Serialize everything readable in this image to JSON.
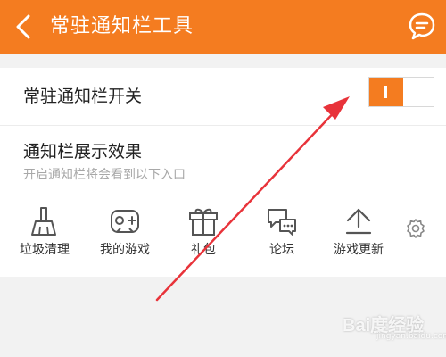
{
  "header": {
    "title": "常驻通知栏工具",
    "back_icon": "chevron-left-icon",
    "chat_icon": "chat-bubble-icon",
    "bg_color": "#f47c20"
  },
  "toggle": {
    "label": "常驻通知栏开关",
    "state": "on",
    "accent_color": "#f47c20"
  },
  "effect": {
    "title": "通知栏展示效果",
    "subtitle": "开启通知栏将会看到以下入口"
  },
  "shortcuts": [
    {
      "label": "垃圾清理",
      "icon": "broom-icon"
    },
    {
      "label": "我的游戏",
      "icon": "gamepad-icon"
    },
    {
      "label": "礼包",
      "icon": "gift-icon"
    },
    {
      "label": "论坛",
      "icon": "forum-icon"
    },
    {
      "label": "游戏更新",
      "icon": "upload-icon"
    }
  ],
  "settings_icon": "gear-icon",
  "annotation": {
    "arrow_color": "#e8333a"
  },
  "watermark": {
    "text": "Bai度经验",
    "sub": "jingyan.baidu.com"
  }
}
